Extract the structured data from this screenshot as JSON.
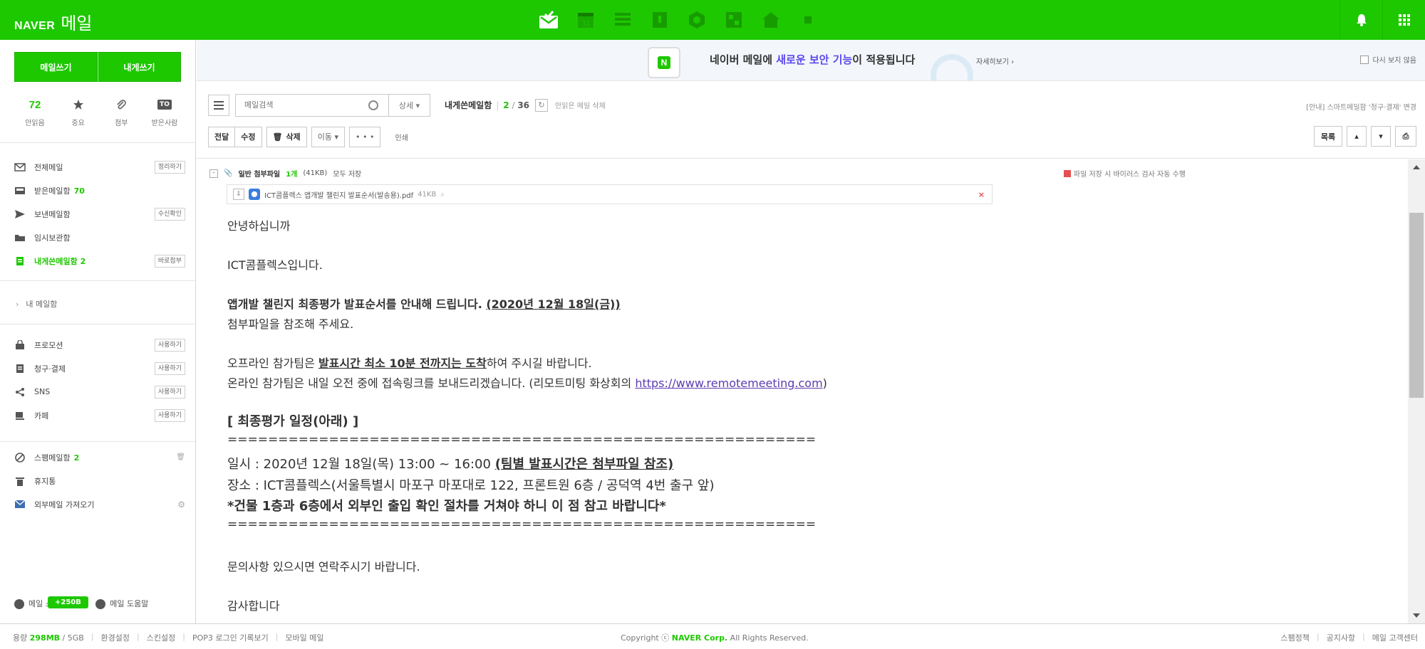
{
  "app": {
    "brand": "NAVER",
    "title": "메일"
  },
  "topbar": {
    "apps": [
      "mail-icon",
      "calendar-icon",
      "contacts-icon",
      "memo-icon",
      "drive-icon",
      "office-icon",
      "myhome-icon",
      "more-icon"
    ],
    "alarm_icon": "bell-icon",
    "grid_icon": "apps-grid-icon"
  },
  "sidebar": {
    "write_button": "메일쓰기",
    "write_me_button": "내게쓰기",
    "quick": [
      {
        "value": "72",
        "label": "안읽음"
      },
      {
        "icon": "★",
        "label": "중요"
      },
      {
        "icon": "📎",
        "label": "첨부"
      },
      {
        "icon": "TO",
        "label": "받은사람"
      }
    ],
    "folders": [
      {
        "name": "전체메일",
        "count": "",
        "button": "정리하기"
      },
      {
        "name": "받은메일함",
        "count": "70",
        "button": ""
      },
      {
        "name": "보낸메일함",
        "count": "",
        "button": "수신확인"
      },
      {
        "name": "임시보관함",
        "count": "",
        "button": ""
      },
      {
        "name": "내게쓴메일함",
        "count": "2",
        "button": "바로첨부"
      }
    ],
    "my_folders": "내 메일함",
    "extra_folders": [
      {
        "name": "프로모션",
        "button": "사용하기"
      },
      {
        "name": "청구·결제",
        "button": "사용하기"
      },
      {
        "name": "SNS",
        "button": "사용하기"
      },
      {
        "name": "카페",
        "button": "사용하기"
      }
    ],
    "spam": {
      "name": "스팸메일함",
      "count": "2"
    },
    "trash": "휴지통",
    "external": "외부메일 가져오기",
    "footer": {
      "mail_storage": "메일 스토리지",
      "mail_help": "메일 도움말",
      "badge": "+250B"
    }
  },
  "banner": {
    "logo_text": "N",
    "text_pre": "네이버 메일에 ",
    "text_hl": "새로운 보안 기능",
    "text_post": "이 적용됩니다",
    "more": "자세히보기 ›",
    "dont_show": "다시 보지 않음"
  },
  "toolbar": {
    "search_placeholder": "메일검색",
    "detail": "상세 ▾",
    "folder_name": "내게쓴메일함",
    "unread": "2",
    "total": "36",
    "delete_unread": "안읽은 메일 삭제",
    "notice": "[안내] 스마트메일함 '청구·결제' 변경",
    "forward": "전달",
    "edit": "수정",
    "delete": "삭제",
    "move": "이동 ▾",
    "more": "• • •",
    "print": "인쇄",
    "list": "목록"
  },
  "attachment": {
    "type": "일반 첨부파일",
    "count": "1개",
    "size": "(41KB)",
    "save_all": "모두 저장",
    "virus_note": "파일 저장 시 바이러스 검사 자동 수행",
    "filename": "ICT콤플렉스 앱개발 챌린지 발표순서(발송용).pdf",
    "filesize": "41KB"
  },
  "body": {
    "greeting": "안녕하십니까",
    "intro": "ICT콤플렉스입니다.",
    "line1_bold": "앱개발 챌린지 최종평가 발표순서를 안내해 드립니다. ",
    "line1_date": "(2020년 12월 18일(금))",
    "line2": "첨부파일을 참조해 주세요.",
    "line3_pre": "오프라인 참가팀은 ",
    "line3_u": "발표시간 최소 10분 전까지는 도착",
    "line3_post": "하여 주시길 바랍니다.",
    "line4_pre": "온라인 참가팀은 내일 오전 중에 접속링크를 보내드리겠습니다. (리모트미팅 화상회의 ",
    "line4_link": "https://www.remotemeeting.com",
    "line4_post": ")",
    "schedule_title": "[ 최종평가 일정(아래) ]",
    "separator": "==========================================================",
    "date_pre": "일시 : 2020년 12월 18일(목) 13:00 ~ 16:00 ",
    "date_bold": "(팀별 발표시간은 첨부파일 참조)",
    "place": "장소 : ICT콤플렉스(서울특별시 마포구 마포대로 122, 프론트원 6층 / 공덕역 4번 출구 앞)",
    "notice": " *건물 1층과 6층에서 외부인 출입 확인 절차를 거쳐야 하니 이 점 참고 바랍니다*",
    "contact": "문의사항 있으시면 연락주시기 바랍니다.",
    "thanks": "감사합니다"
  },
  "bottombar": {
    "capacity_label": "용량",
    "used": "298MB",
    "total": "/ 5GB",
    "links": [
      "환경설정",
      "스킨설정",
      "POP3 로그인 기록보기",
      "모바일 메일"
    ],
    "copyright_pre": "Copyright ⓒ ",
    "copyright_brand": "NAVER Corp.",
    "copyright_post": " All Rights Reserved.",
    "right_links": [
      "스팸정책",
      "공지사항",
      "메일 고객센터"
    ]
  }
}
